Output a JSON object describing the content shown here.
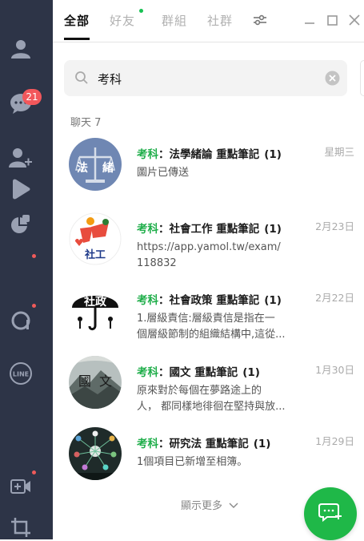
{
  "sidebar": {
    "chat_badge": "21",
    "icons": [
      "friends-icon",
      "chats-icon",
      "add-friend-icon",
      "voom-icon",
      "today-icon",
      "openchat-icon",
      "line-icon",
      "video-call-icon",
      "crop-icon"
    ]
  },
  "tabs": [
    {
      "label": "全部"
    },
    {
      "label": "好友"
    },
    {
      "label": "群組"
    },
    {
      "label": "社群"
    }
  ],
  "search": {
    "value": "考科"
  },
  "section": {
    "title": "聊天 7"
  },
  "chats": [
    {
      "keyword": "考科",
      "name": "：法學緒論 重點筆記",
      "count": "(1)",
      "preview": [
        "圖片已傳送"
      ],
      "date": "星期三"
    },
    {
      "keyword": "考科",
      "name": "：社會工作 重點筆記",
      "count": "(1)",
      "preview": [
        "https://app.yamol.tw/exam/",
        "118832"
      ],
      "date": "2月23日"
    },
    {
      "keyword": "考科",
      "name": "：社會政策 重點筆記",
      "count": "(1)",
      "preview": [
        "1.層級責信:層級責信是指在一",
        "個層級節制的組織結構中,這從..."
      ],
      "date": "2月22日"
    },
    {
      "keyword": "考科",
      "name": "：國文 重點筆記",
      "count": "(1)",
      "preview": [
        "原來對於每個在夢路途上的",
        "人， 都同樣地徘徊在堅持與放..."
      ],
      "date": "1月30日"
    },
    {
      "keyword": "考科",
      "name": "：研究法 重點筆記",
      "count": "(1)",
      "preview": [
        "1個項目已新增至相簿。"
      ],
      "date": "1月29日"
    }
  ],
  "avatar_text": {
    "a1": "法",
    "a2": "緒",
    "a3": "社工",
    "a4": "社政",
    "a5": "國",
    "a6": "文"
  },
  "show_more": "顯示更多",
  "colors": {
    "sidebar": "#2d3447",
    "accent": "#1fb848",
    "highlight": "#1fae4a",
    "badge": "#f2575b"
  }
}
